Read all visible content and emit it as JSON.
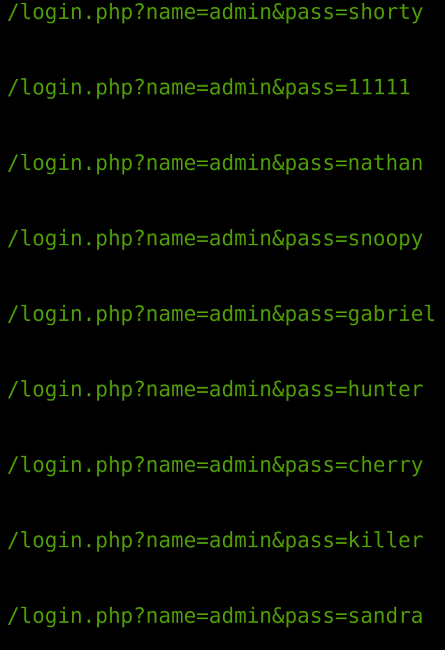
{
  "terminal": {
    "text_color": "#4e9a06",
    "background_color": "#000000",
    "lines": [
      "/login.php?name=admin&pass=shorty",
      "/login.php?name=admin&pass=11111",
      "/login.php?name=admin&pass=nathan",
      "/login.php?name=admin&pass=snoopy",
      "/login.php?name=admin&pass=gabriel",
      "/login.php?name=admin&pass=hunter",
      "/login.php?name=admin&pass=cherry",
      "/login.php?name=admin&pass=killer",
      "/login.php?name=admin&pass=sandra"
    ]
  }
}
